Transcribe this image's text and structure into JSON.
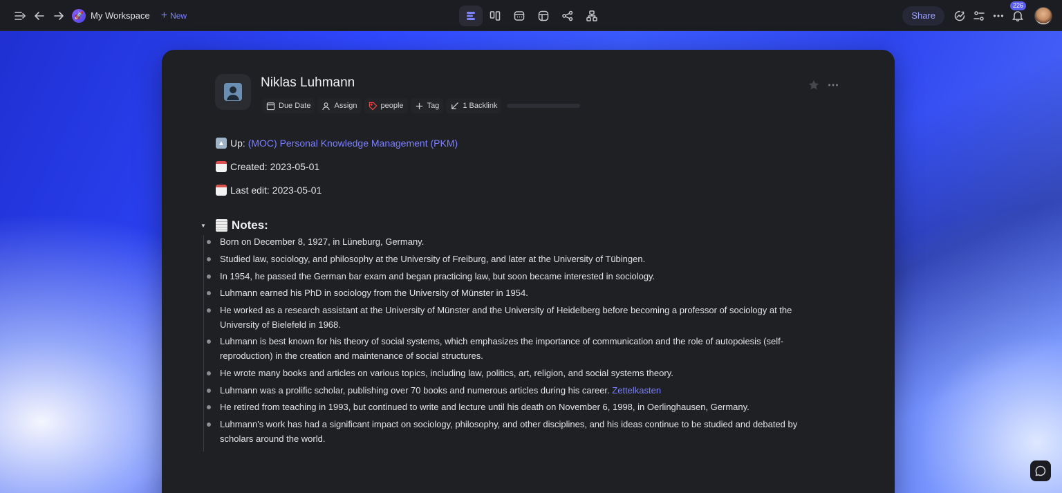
{
  "topbar": {
    "workspace_name": "My Workspace",
    "new_label": "New",
    "share_label": "Share",
    "notification_count": "226"
  },
  "page": {
    "title": "Niklas Luhmann",
    "properties": {
      "due_date": "Due Date",
      "assign": "Assign",
      "tag_people": "people",
      "add_tag": "Tag",
      "backlinks": "1 Backlink"
    },
    "up_label": "Up:",
    "up_link": "(MOC) Personal Knowledge Management (PKM)",
    "created": "Created: 2023-05-01",
    "last_edit": "Last edit: 2023-05-01",
    "notes_heading": "Notes:",
    "notes": [
      "Born on December 8, 1927, in Lüneburg, Germany.",
      "Studied law, sociology, and philosophy at the University of Freiburg, and later at the University of Tübingen.",
      "In 1954, he passed the German bar exam and began practicing law, but soon became interested in sociology.",
      "Luhmann earned his PhD in sociology from the University of Münster in 1954.",
      "He worked as a research assistant at the University of Münster and the University of Heidelberg before becoming a professor of sociology at the University of Bielefeld in 1968.",
      "Luhmann is best known for his theory of social systems, which emphasizes the importance of communication and the role of autopoiesis (self-reproduction) in the creation and maintenance of social structures.",
      "He wrote many books and articles on various topics, including law, politics, art, religion, and social systems theory.",
      "Luhmann was a prolific scholar, publishing over 70 books and numerous articles during his career.",
      "He retired from teaching in 1993, but continued to write and lecture until his death on November 6, 1998, in Oerlinghausen, Germany.",
      "Luhmann's work has had a significant impact on sociology, philosophy, and other disciplines, and his ideas continue to be studied and debated by scholars around the world."
    ],
    "note_8_link": "Zettelkasten"
  },
  "colors": {
    "accent": "#7c7fff",
    "card_bg": "#1f2024",
    "topbar_bg": "#1c1d22"
  }
}
